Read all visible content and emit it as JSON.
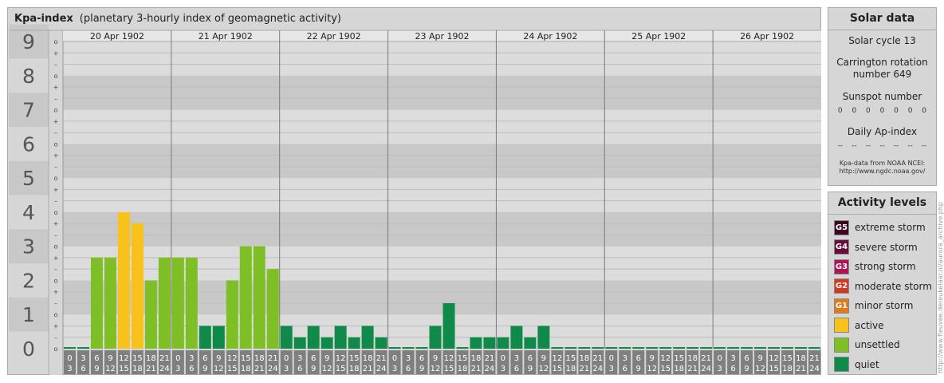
{
  "header": {
    "title": "Kpa-index",
    "subtitle": "(planetary 3-hourly index of geomagnetic activity)"
  },
  "chart_data": {
    "type": "bar",
    "days": [
      "20 Apr 1902",
      "21 Apr 1902",
      "22 Apr 1902",
      "23 Apr 1902",
      "24 Apr 1902",
      "25 Apr 1902",
      "26 Apr 1902"
    ],
    "interval_starts": [
      "0",
      "3",
      "6",
      "9",
      "12",
      "15",
      "18",
      "21"
    ],
    "interval_ends": [
      "3",
      "6",
      "9",
      "12",
      "15",
      "18",
      "21",
      "24"
    ],
    "y_labels": [
      "0",
      "1",
      "2",
      "3",
      "4",
      "5",
      "6",
      "7",
      "8",
      "9"
    ],
    "thirds_symbols": [
      "o",
      "+",
      "–"
    ],
    "ylim": [
      0,
      9
    ],
    "values": [
      [
        0.0,
        0.0,
        2.667,
        2.667,
        4.0,
        3.667,
        2.0,
        2.667
      ],
      [
        2.667,
        2.667,
        0.667,
        0.667,
        2.0,
        3.0,
        3.0,
        2.333
      ],
      [
        0.667,
        0.333,
        0.667,
        0.333,
        0.667,
        0.333,
        0.667,
        0.333
      ],
      [
        0.0,
        0.0,
        0.0,
        0.667,
        1.333,
        0.0,
        0.333,
        0.333
      ],
      [
        0.333,
        0.667,
        0.333,
        0.667,
        0.0,
        0.0,
        0.0,
        0.0
      ],
      [
        0.0,
        0.0,
        0.0,
        0.0,
        0.0,
        0.0,
        0.0,
        0.0
      ],
      [
        0.0,
        0.0,
        0.0,
        0.0,
        0.0,
        0.0,
        0.0,
        0.0
      ]
    ],
    "activity_colors": {
      "quiet": "#0f8a48",
      "unsettled": "#7fbf26",
      "active": "#f8c21b",
      "minor_storm": "#e07a1f",
      "moderate_storm": "#cf3a21",
      "strong_storm": "#b01458",
      "severe_storm": "#6a0c3e",
      "extreme_storm": "#3d0721"
    }
  },
  "solar": {
    "title": "Solar data",
    "cycle": "Solar cycle 13",
    "carrington_line1": "Carrington rotation",
    "carrington_line2": "number 649",
    "sunspot_label": "Sunspot number",
    "sunspot_values": [
      "0",
      "0",
      "0",
      "0",
      "0",
      "0",
      "0"
    ],
    "ap_label": "Daily Ap-index",
    "ap_values": [
      "--",
      "--",
      "--",
      "--",
      "--",
      "--",
      "--"
    ],
    "source_line1": "Kpa-data from NOAA NCEI:",
    "source_line2": "http://www.ngdc.noaa.gov/"
  },
  "activity": {
    "title": "Activity levels",
    "levels": [
      {
        "code": "G5",
        "label": "extreme storm",
        "color": "#3d0721"
      },
      {
        "code": "G4",
        "label": "severe storm",
        "color": "#6a0c3e"
      },
      {
        "code": "G3",
        "label": "strong storm",
        "color": "#b01458"
      },
      {
        "code": "G2",
        "label": "moderate storm",
        "color": "#cf3a21"
      },
      {
        "code": "G1",
        "label": "minor storm",
        "color": "#e07a1f"
      },
      {
        "code": "",
        "label": "active",
        "color": "#f8c21b"
      },
      {
        "code": "",
        "label": "unsettled",
        "color": "#7fbf26"
      },
      {
        "code": "",
        "label": "quiet",
        "color": "#0f8a48"
      }
    ]
  },
  "watermark": "http://www.fleuvee.dereukelaar.nl/aurora_archive.php"
}
